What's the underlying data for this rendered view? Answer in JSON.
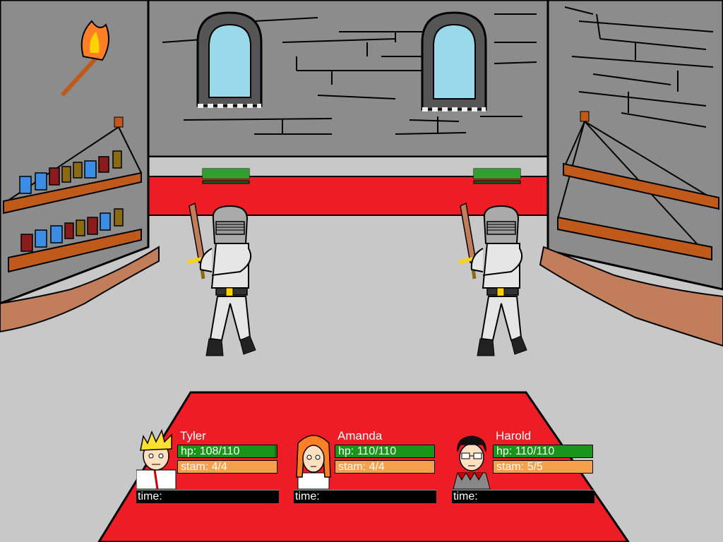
{
  "party": [
    {
      "name": "Tyler",
      "hp_label": "hp: 108/110",
      "hp_fraction": 0.982,
      "stam_label": "stam: 4/4",
      "stam_fraction": 1.0,
      "time_label": "time:",
      "time_fraction": 0.0,
      "portrait": "blond-spiky-hair-boy-portrait"
    },
    {
      "name": "Amanda",
      "hp_label": "hp: 110/110",
      "hp_fraction": 1.0,
      "stam_label": "stam: 4/4",
      "stam_fraction": 1.0,
      "time_label": "time:",
      "time_fraction": 0.0,
      "portrait": "orange-hair-girl-portrait"
    },
    {
      "name": "Harold",
      "hp_label": "hp: 110/110",
      "hp_fraction": 1.0,
      "stam_label": "stam: 5/5",
      "stam_fraction": 1.0,
      "time_label": "time:",
      "time_fraction": 0.0,
      "portrait": "black-hair-glasses-boy-portrait"
    }
  ],
  "enemies": [
    {
      "id": "knight-left",
      "hp_fraction": 1.0
    },
    {
      "id": "knight-right",
      "hp_fraction": 1.0
    }
  ],
  "colors": {
    "carpet": "#ee1c24",
    "hp_bar": "#199619",
    "stam_bar": "#f5a04a",
    "wall": "#8c8c8c",
    "floor": "#c8c8c8"
  }
}
